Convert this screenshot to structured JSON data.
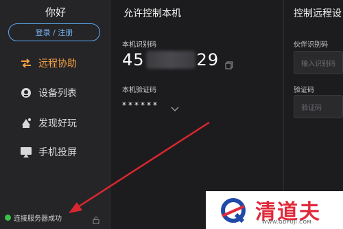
{
  "sidebar": {
    "greeting": "你好",
    "login_label": "登录 / 注册",
    "items": [
      {
        "label": "远程协助",
        "icon": "swap-arrows-icon",
        "active": true
      },
      {
        "label": "设备列表",
        "icon": "device-list-icon",
        "active": false
      },
      {
        "label": "发现好玩",
        "icon": "discover-icon",
        "active": false
      },
      {
        "label": "手机投屏",
        "icon": "screen-cast-icon",
        "active": false
      }
    ],
    "status": "连接服务器成功",
    "status_color": "#39c24a"
  },
  "allow": {
    "title": "允许控制本机",
    "id_label": "本机识别码",
    "id_prefix": "45",
    "id_suffix": "29",
    "pwd_label": "本机验证码",
    "pwd_value": "******"
  },
  "control": {
    "title": "控制远程设",
    "partner_label": "伙伴识别码",
    "partner_placeholder": "输入识别码",
    "verify_label": "验证码",
    "verify_placeholder": "验证码"
  },
  "watermark": {
    "brand": "清道夫",
    "url": "WWW.QDFUJI.COM"
  },
  "colors": {
    "accent": "#f5a044",
    "login_border": "#5aa8f0",
    "arrow": "#d9272f",
    "watermark_red": "#e0293a"
  }
}
